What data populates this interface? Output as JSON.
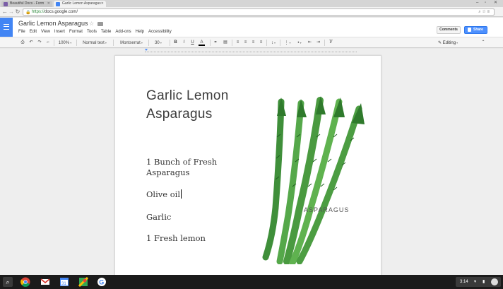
{
  "browser": {
    "tabs": [
      {
        "label": "Beautiful Docs - Form"
      },
      {
        "label": "Garlic Lemon Asparagus"
      }
    ],
    "url": {
      "scheme": "https://",
      "host": "docs.google.com/"
    }
  },
  "docs": {
    "title": "Garlic Lemon Asparagus",
    "menu": [
      "File",
      "Edit",
      "View",
      "Insert",
      "Format",
      "Tools",
      "Table",
      "Add-ons",
      "Help",
      "Accessibility"
    ],
    "comments_label": "Comments",
    "share_label": "Share"
  },
  "format_toolbar": {
    "zoom": "100%",
    "style": "Normal text",
    "font": "Montserrat",
    "size": "30",
    "mode": "Editing"
  },
  "document": {
    "heading": "Garlic Lemon Asparagus",
    "ingredients": [
      "1 Bunch of Fresh Asparagus",
      "Olive oil",
      "Garlic",
      "1 Fresh lemon"
    ],
    "illustration_caption": "ASPARAGUS"
  },
  "taskbar": {
    "time": "3:14"
  },
  "colors": {
    "docs_blue": "#4285f4",
    "share_blue": "#4d90fe",
    "asparagus_green": "#4caf50"
  }
}
